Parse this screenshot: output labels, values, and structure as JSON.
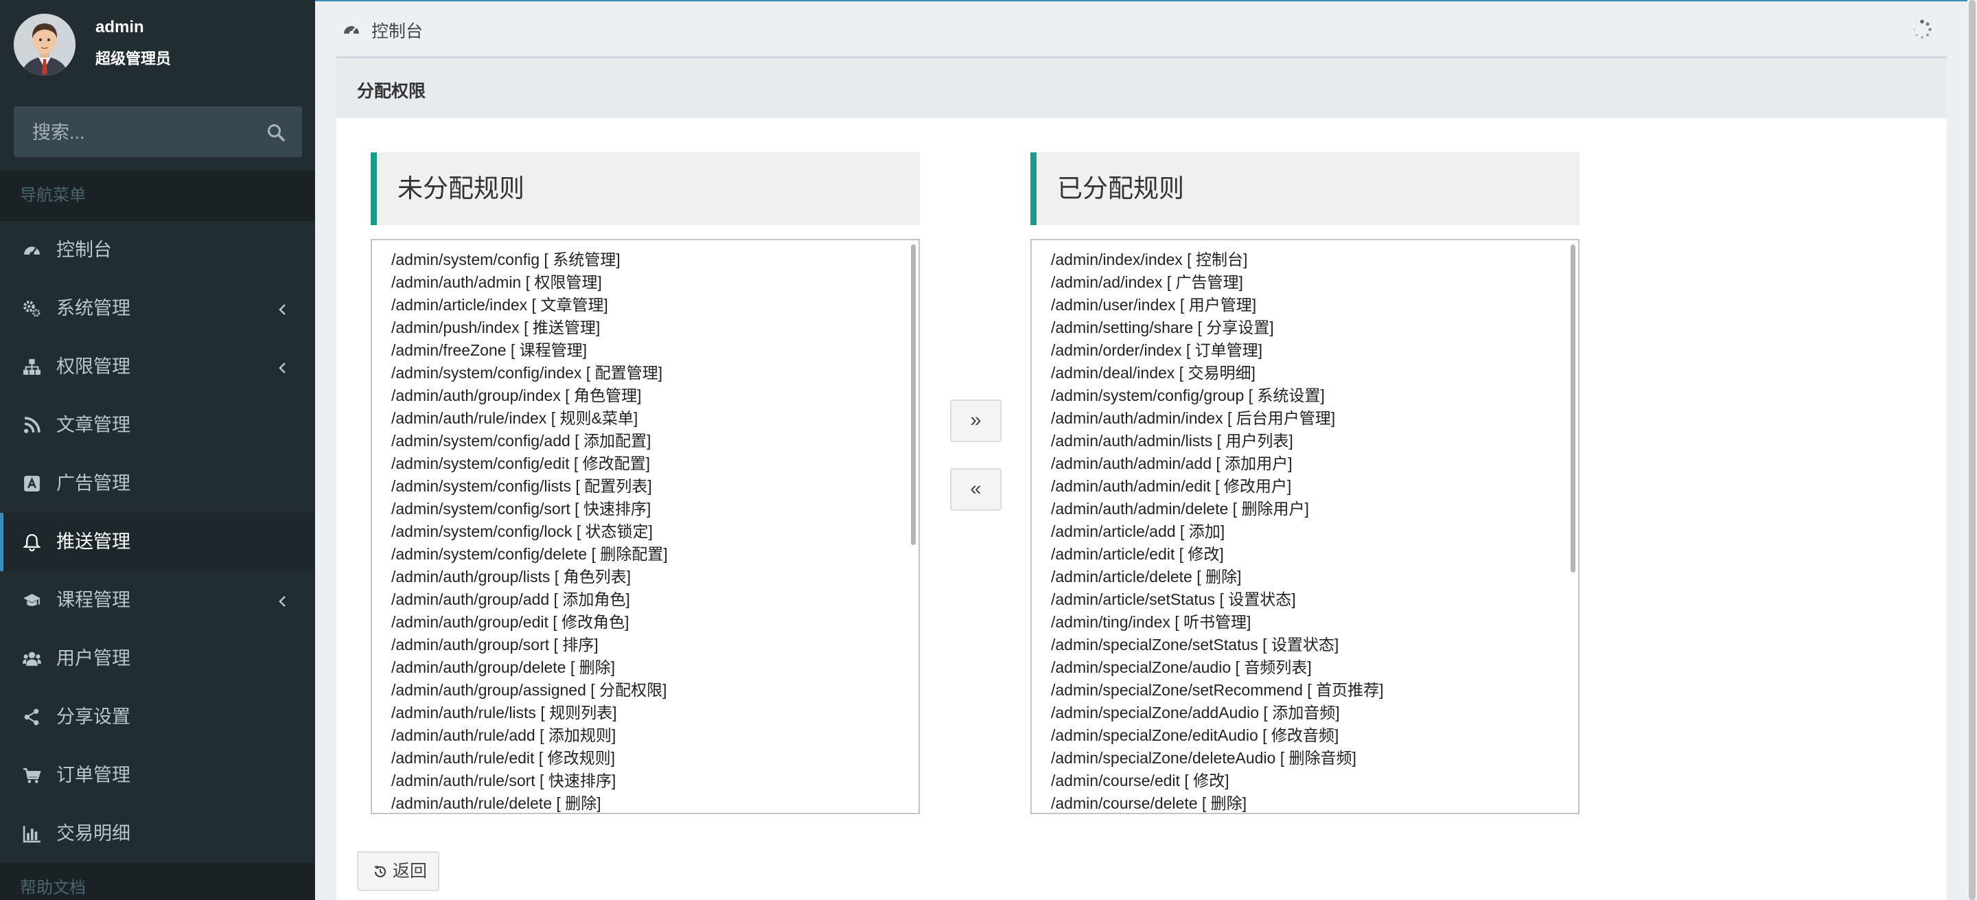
{
  "user": {
    "name": "admin",
    "role": "超级管理员"
  },
  "search": {
    "placeholder": "搜索..."
  },
  "sidebar": {
    "header_nav": "导航菜单",
    "header_help": "帮助文档",
    "items": [
      {
        "label": "控制台",
        "icon": "dashboard-icon",
        "has_submenu": false,
        "active": false
      },
      {
        "label": "系统管理",
        "icon": "gears-icon",
        "has_submenu": true,
        "active": false
      },
      {
        "label": "权限管理",
        "icon": "sitemap-icon",
        "has_submenu": true,
        "active": false
      },
      {
        "label": "文章管理",
        "icon": "rss-icon",
        "has_submenu": false,
        "active": false
      },
      {
        "label": "广告管理",
        "icon": "ad-icon",
        "has_submenu": false,
        "active": false
      },
      {
        "label": "推送管理",
        "icon": "bell-icon",
        "has_submenu": false,
        "active": true
      },
      {
        "label": "课程管理",
        "icon": "graduation-cap-icon",
        "has_submenu": true,
        "active": false
      },
      {
        "label": "用户管理",
        "icon": "users-icon",
        "has_submenu": false,
        "active": false
      },
      {
        "label": "分享设置",
        "icon": "share-icon",
        "has_submenu": false,
        "active": false
      },
      {
        "label": "订单管理",
        "icon": "cart-icon",
        "has_submenu": false,
        "active": false
      },
      {
        "label": "交易明细",
        "icon": "bar-chart-icon",
        "has_submenu": false,
        "active": false
      }
    ]
  },
  "topbar": {
    "title": "控制台"
  },
  "box": {
    "title": "分配权限"
  },
  "unassigned": {
    "title": "未分配规则",
    "rules": [
      "/admin/system/config [ 系统管理]",
      "/admin/auth/admin [ 权限管理]",
      "/admin/article/index [ 文章管理]",
      "/admin/push/index [ 推送管理]",
      "/admin/freeZone [ 课程管理]",
      "/admin/system/config/index [ 配置管理]",
      "/admin/auth/group/index [ 角色管理]",
      "/admin/auth/rule/index [ 规则&菜单]",
      "/admin/system/config/add [ 添加配置]",
      "/admin/system/config/edit [ 修改配置]",
      "/admin/system/config/lists [ 配置列表]",
      "/admin/system/config/sort [ 快速排序]",
      "/admin/system/config/lock [ 状态锁定]",
      "/admin/system/config/delete [ 删除配置]",
      "/admin/auth/group/lists [ 角色列表]",
      "/admin/auth/group/add [ 添加角色]",
      "/admin/auth/group/edit [ 修改角色]",
      "/admin/auth/group/sort [ 排序]",
      "/admin/auth/group/delete [ 删除]",
      "/admin/auth/group/assigned [ 分配权限]",
      "/admin/auth/rule/lists [ 规则列表]",
      "/admin/auth/rule/add [ 添加规则]",
      "/admin/auth/rule/edit [ 修改规则]",
      "/admin/auth/rule/sort [ 快速排序]",
      "/admin/auth/rule/delete [ 删除]"
    ]
  },
  "assigned": {
    "title": "已分配规则",
    "rules": [
      "/admin/index/index [ 控制台]",
      "/admin/ad/index [ 广告管理]",
      "/admin/user/index [ 用户管理]",
      "/admin/setting/share [ 分享设置]",
      "/admin/order/index [ 订单管理]",
      "/admin/deal/index [ 交易明细]",
      "/admin/system/config/group [ 系统设置]",
      "/admin/auth/admin/index [ 后台用户管理]",
      "/admin/auth/admin/lists [ 用户列表]",
      "/admin/auth/admin/add [ 添加用户]",
      "/admin/auth/admin/edit [ 修改用户]",
      "/admin/auth/admin/delete [ 删除用户]",
      "/admin/article/add [ 添加]",
      "/admin/article/edit [ 修改]",
      "/admin/article/delete [ 删除]",
      "/admin/article/setStatus [ 设置状态]",
      "/admin/ting/index [ 听书管理]",
      "/admin/specialZone/setStatus [ 设置状态]",
      "/admin/specialZone/audio [ 音频列表]",
      "/admin/specialZone/setRecommend [ 首页推荐]",
      "/admin/specialZone/addAudio [ 添加音频]",
      "/admin/specialZone/editAudio [ 修改音频]",
      "/admin/specialZone/deleteAudio [ 删除音频]",
      "/admin/course/edit [ 修改]",
      "/admin/course/delete [ 删除]"
    ]
  },
  "buttons": {
    "move_right": "»",
    "move_left": "«",
    "back": "返回"
  },
  "colors": {
    "sidebar_bg": "#222d32",
    "accent": "#3c8dbc",
    "panel_accent": "#1a9c8c"
  }
}
